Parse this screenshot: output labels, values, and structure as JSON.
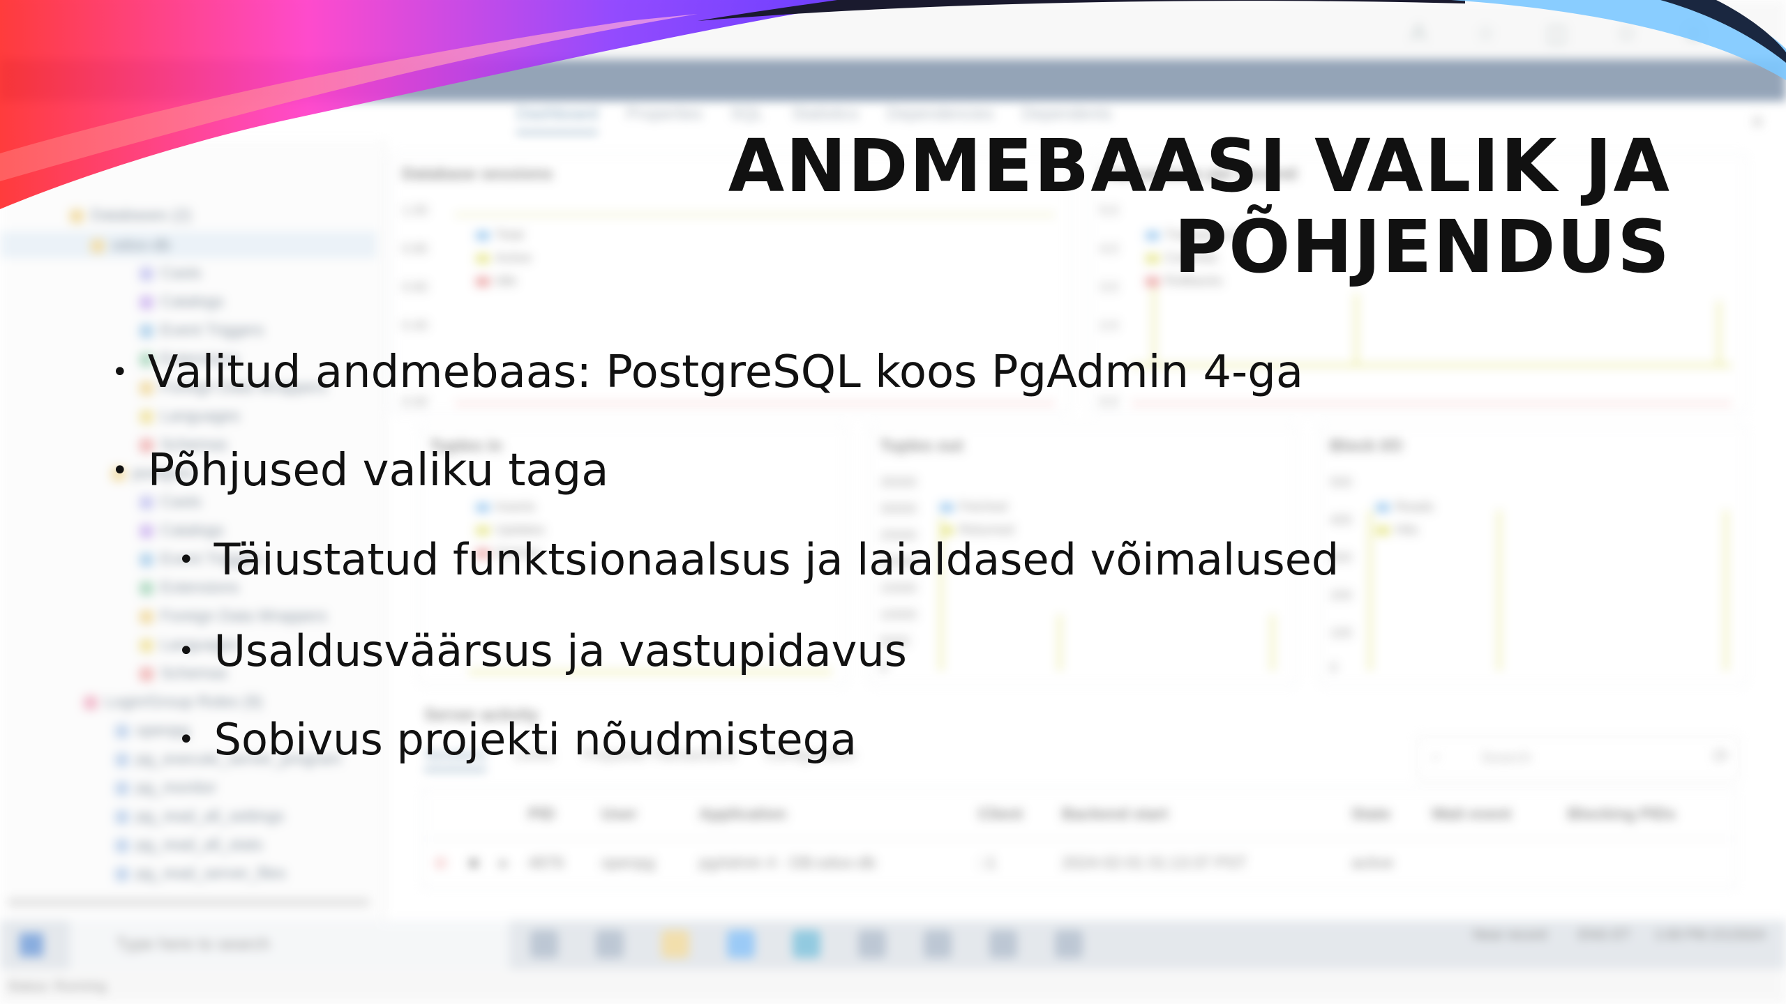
{
  "slide": {
    "title": "ANDMEBAASI VALIK JA PÕHJENDUS",
    "bullets": [
      {
        "level": 1,
        "text": "Valitud andmebaas: PostgreSQL koos PgAdmin 4-ga"
      },
      {
        "level": 1,
        "text": "Põhjused valiku taga"
      },
      {
        "level": 2,
        "text": "Täiustatud funktsionaalsus ja laialdased võimalused"
      },
      {
        "level": 2,
        "text": "Usaldusväärsus ja vastupidavus"
      },
      {
        "level": 2,
        "text": "Sobivus projekti nõudmistega"
      }
    ],
    "bullet_glyph": "•",
    "ribbon_colors": [
      "#ff2d2d",
      "#ff3cc8",
      "#9a3cff",
      "#1a1a2e",
      "#4fb3ff"
    ]
  },
  "background": {
    "tabs": [
      "Dashboard",
      "Properties",
      "SQL",
      "Statistics",
      "Dependencies",
      "Dependents"
    ],
    "tree": [
      {
        "text": "Databases (2)",
        "indent": 1
      },
      {
        "text": "odoo-db",
        "indent": 2
      },
      {
        "text": "Casts",
        "indent": 3
      },
      {
        "text": "Catalogs",
        "indent": 3
      },
      {
        "text": "Event Triggers",
        "indent": 3
      },
      {
        "text": "Extensions",
        "indent": 3
      },
      {
        "text": "Foreign Data Wrappers",
        "indent": 3
      },
      {
        "text": "Languages",
        "indent": 3
      },
      {
        "text": "Schemas",
        "indent": 3
      },
      {
        "text": "postgres",
        "indent": 2
      },
      {
        "text": "Casts",
        "indent": 3
      },
      {
        "text": "Catalogs",
        "indent": 3
      },
      {
        "text": "Event Triggers",
        "indent": 3
      },
      {
        "text": "Extensions",
        "indent": 3
      },
      {
        "text": "Foreign Data Wrappers",
        "indent": 3
      },
      {
        "text": "Languages",
        "indent": 3
      },
      {
        "text": "Schemas",
        "indent": 3
      },
      {
        "text": "Login/Group Roles (9)",
        "indent": 1
      },
      {
        "text": "openpg",
        "indent": 2
      },
      {
        "text": "pg_execute_server_program",
        "indent": 2
      },
      {
        "text": "pg_monitor",
        "indent": 2
      },
      {
        "text": "pg_read_all_settings",
        "indent": 2
      },
      {
        "text": "pg_read_all_stats",
        "indent": 2
      },
      {
        "text": "pg_read_server_files",
        "indent": 2
      }
    ],
    "panels": {
      "sessions": {
        "title": "Database sessions",
        "axis": [
          "1.00",
          "0.80",
          "0.60",
          "0.40",
          "0.00"
        ],
        "legend": [
          "Total",
          "Active",
          "Idle"
        ]
      },
      "transactions": {
        "title": "Transactions per second",
        "axis": [
          "5.0",
          "4.0",
          "3.0",
          "2.0",
          "0.0"
        ],
        "legend": [
          "Transactions",
          "Commits",
          "Rollbacks"
        ]
      },
      "tuples_in": {
        "title": "Tuples in",
        "legend": [
          "Inserts",
          "Updates",
          "Deletes"
        ]
      },
      "tuples_out": {
        "title": "Tuples out",
        "axis": [
          "35000",
          "30000",
          "25000",
          "20000",
          "15000",
          "10000",
          "5000",
          "0"
        ],
        "legend": [
          "Fetched",
          "Returned"
        ]
      },
      "block_io": {
        "title": "Block I/O",
        "axis": [
          "500",
          "400",
          "300",
          "200",
          "100",
          "0"
        ],
        "legend": [
          "Reads",
          "Hits"
        ]
      }
    },
    "server_activity": {
      "title": "Server activity",
      "tabs": [
        "Sessions",
        "Locks",
        "Prepared Transactions",
        "Configuration"
      ],
      "search_placeholder": "Search",
      "columns": [
        "PID",
        "User",
        "Application",
        "Client",
        "Backend start",
        "State",
        "Wait event",
        "Blocking PIDs"
      ],
      "rows": [
        [
          "4876",
          "openpg",
          "pgAdmin 4 - DB:odoo-db",
          "::1",
          "2024-02-01 01:13:37 PST",
          "active",
          "",
          ""
        ]
      ]
    },
    "taskbar": {
      "search_placeholder": "Type here to search",
      "weather": "Near record",
      "lang1": "ENG",
      "lang2": "ET",
      "time": "1:00 PM",
      "date": "2/1/2024"
    },
    "status": "Status: Running"
  }
}
